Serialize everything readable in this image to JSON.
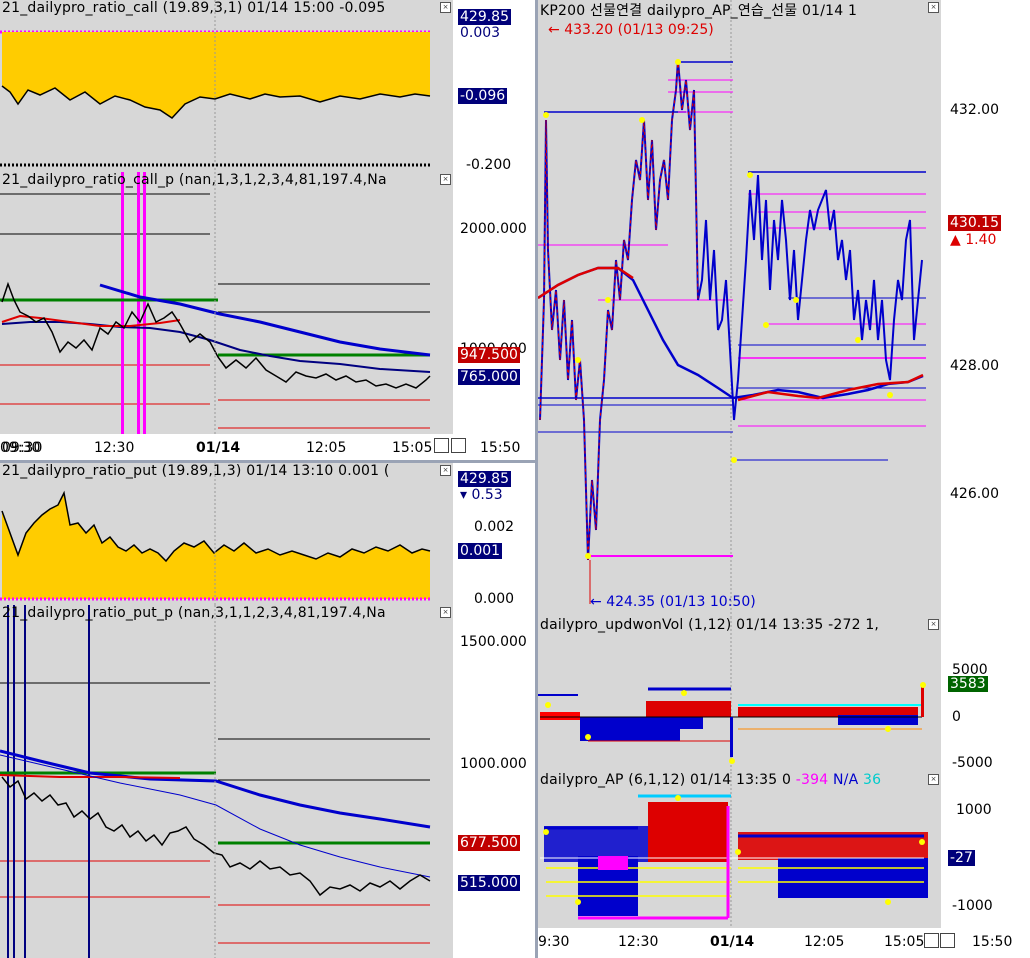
{
  "window": {
    "time_footer": "15:50"
  },
  "left": {
    "call": {
      "title": "21_dailypro_ratio_call  (19.89,3,1) 01/14 15:00 -0.095",
      "axis": [
        "0.003",
        "-0.200"
      ],
      "tag_top": "429.85",
      "tag_val": "-0.096"
    },
    "call_p": {
      "title": "21_dailypro_ratio_call_p   (nan,1,3,1,2,3,4,81,197.4,Na",
      "axis": [
        "2000.000",
        "1000.000"
      ],
      "tag_red": "947.500",
      "tag_navy": "765.000",
      "xticks": [
        "09:30",
        "12:30",
        "01/14",
        "12:05",
        "15:05"
      ]
    },
    "put": {
      "title": "21_dailypro_ratio_put  (19.89,1,3) 01/14 13:10 0.001 (",
      "axis": [
        "0.002",
        "0.000"
      ],
      "tag_top": "429.85",
      "tag_small": "0.53",
      "tag_val": "0.001"
    },
    "put_p": {
      "title": "21_dailypro_ratio_put_p   (nan,3,1,1,2,3,4,81,197.4,Na",
      "axis": [
        "1500.000",
        "1000.000"
      ],
      "tag_red": "677.500",
      "tag_navy": "515.000"
    }
  },
  "right": {
    "main": {
      "title": "KP200 선물연결   dailypro_AP_연습_선물   01/14 1",
      "axis": [
        "432.00",
        "430.00",
        "428.00",
        "426.00"
      ],
      "tag_price": "430.15",
      "tag_change": "1.40",
      "high_label": "433.20 (01/13 09:25)",
      "low_label": "424.35 (01/13 10:50)"
    },
    "vol": {
      "title": "dailypro_updwonVol   (1,12) 01/14 13:35  -272  1,",
      "axis": [
        "5000",
        "0",
        "-5000"
      ],
      "tag_val": "3583"
    },
    "ap": {
      "title": "dailypro_AP   (6,1,12) 01/14 13:35  0",
      "title_v1": "-394",
      "title_v2": "N/A",
      "title_v3": "36",
      "axis": [
        "1000",
        "-1000"
      ],
      "tag_val": "-27",
      "xticks": [
        "9:30",
        "12:30",
        "01/14",
        "12:05",
        "15:05"
      ]
    }
  },
  "colors": {
    "plot_bg": "#d7d7d7",
    "fill": "#ffcc00",
    "blue": "#0000cc",
    "red": "#dd0000",
    "green": "#008000",
    "magenta": "#ff00ff",
    "navy": "#00007a"
  }
}
